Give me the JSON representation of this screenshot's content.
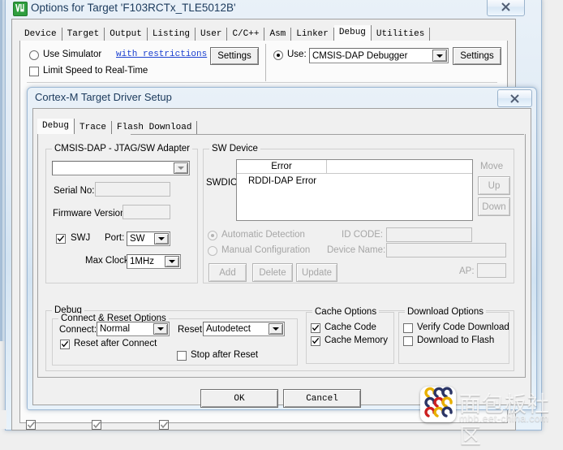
{
  "options_window": {
    "title": "Options for Target 'F103RCTx_TLE5012B'",
    "app_icon": "keil-uvision-icon",
    "close_label": "✕",
    "tabs": [
      {
        "label": "Device",
        "selected": false
      },
      {
        "label": "Target",
        "selected": false
      },
      {
        "label": "Output",
        "selected": false
      },
      {
        "label": "Listing",
        "selected": false
      },
      {
        "label": "User",
        "selected": false
      },
      {
        "label": "C/C++",
        "selected": false
      },
      {
        "label": "Asm",
        "selected": false
      },
      {
        "label": "Linker",
        "selected": false
      },
      {
        "label": "Debug",
        "selected": true
      },
      {
        "label": "Utilities",
        "selected": false
      }
    ],
    "debug_tab": {
      "use_simulator_label": "Use Simulator",
      "use_simulator_checked": false,
      "with_restrictions_link": "with restrictions",
      "simulator_settings_label": "Settings",
      "limit_speed_label": "Limit Speed to Real-Time",
      "limit_speed_checked": false,
      "use_label": "Use:",
      "use_radio_checked": true,
      "debugger_value": "CMSIS-DAP Debugger",
      "debugger_settings_label": "Settings"
    }
  },
  "driver_dialog": {
    "title": "Cortex-M Target Driver Setup",
    "close_label": "✕",
    "tabs": [
      {
        "label": "Debug",
        "selected": true
      },
      {
        "label": "Trace",
        "selected": false
      },
      {
        "label": "Flash Download",
        "selected": false
      }
    ],
    "adapter_group": {
      "legend": "CMSIS-DAP - JTAG/SW Adapter",
      "adapter_combo_value": "",
      "serial_no_label": "Serial No:",
      "serial_no_value": "",
      "firmware_version_label": "Firmware Version:",
      "firmware_version_value": "",
      "swj_label": "SWJ",
      "swj_checked": true,
      "port_label": "Port:",
      "port_value": "SW",
      "max_clock_label": "Max Clock:",
      "max_clock_value": "1MHz"
    },
    "sw_device_group": {
      "legend": "SW Device",
      "swdio_label": "SWDIO",
      "columns": [
        "Error",
        ""
      ],
      "rows": [
        [
          "RDDI-DAP Error",
          ""
        ]
      ],
      "move_label": "Move",
      "up_label": "Up",
      "down_label": "Down",
      "automatic_detection_label": "Automatic Detection",
      "automatic_detection_checked": true,
      "manual_configuration_label": "Manual Configuration",
      "manual_configuration_checked": false,
      "id_code_label": "ID CODE:",
      "id_code_value": "",
      "device_name_label": "Device Name:",
      "device_name_value": "",
      "ap_label": "AP:",
      "ap_value": "",
      "add_label": "Add",
      "delete_label": "Delete",
      "update_label": "Update"
    },
    "debug_group": {
      "legend": "Debug",
      "connect_reset": {
        "legend": "Connect & Reset Options",
        "connect_label": "Connect:",
        "connect_value": "Normal",
        "reset_label": "Reset:",
        "reset_value": "Autodetect",
        "reset_after_connect_label": "Reset after Connect",
        "reset_after_connect_checked": true,
        "stop_after_reset_label": "Stop after Reset",
        "stop_after_reset_checked": false
      },
      "cache_options": {
        "legend": "Cache Options",
        "cache_code_label": "Cache Code",
        "cache_code_checked": true,
        "cache_memory_label": "Cache Memory",
        "cache_memory_checked": true
      },
      "download_options": {
        "legend": "Download Options",
        "verify_code_download_label": "Verify Code Download",
        "verify_code_download_checked": false,
        "download_to_flash_label": "Download to Flash",
        "download_to_flash_checked": false
      }
    },
    "ok_label": "OK",
    "cancel_label": "Cancel"
  },
  "watermark": {
    "text": "面包板社区",
    "subtext": "mbb.eet-china.com"
  },
  "colors": {
    "accent_link": "#1a3fd0",
    "dialog_face": "#f0f0f0",
    "glass_border": "#9cb8d4",
    "title_text": "#1b3a5c",
    "app_icon_green": "#2f9e3f"
  }
}
